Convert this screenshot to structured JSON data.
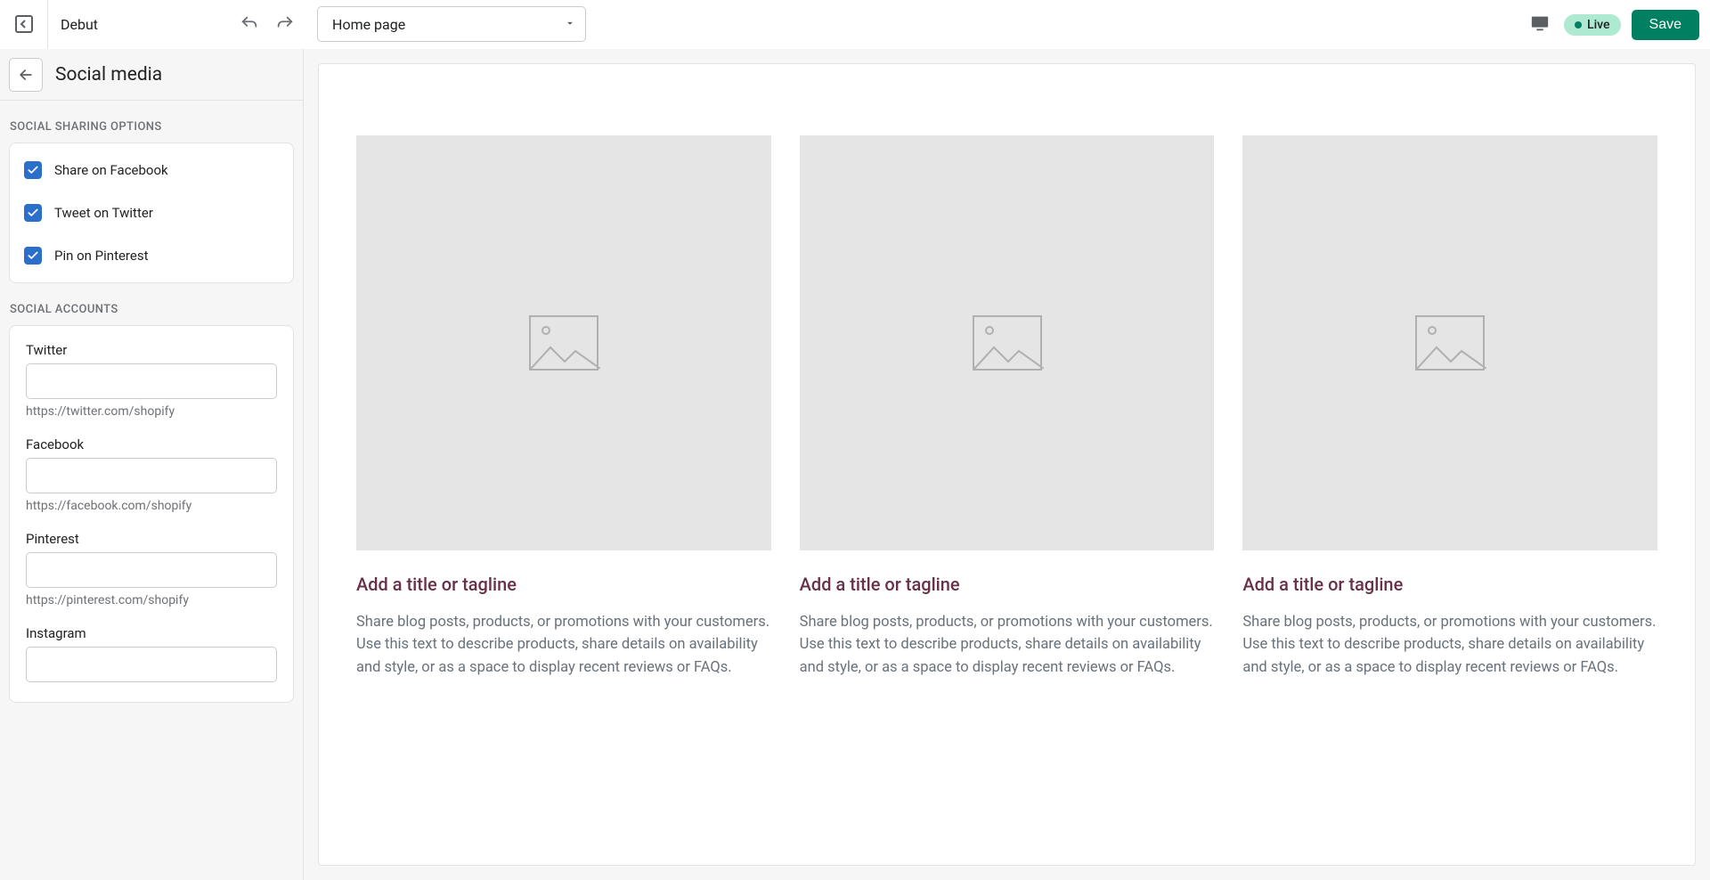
{
  "topbar": {
    "theme_name": "Debut",
    "page_select_value": "Home page",
    "live_label": "Live",
    "save_label": "Save"
  },
  "sidebar": {
    "title": "Social media",
    "section_sharing": "Social sharing options",
    "section_accounts": "Social accounts",
    "sharing_options": [
      {
        "label": "Share on Facebook",
        "checked": true
      },
      {
        "label": "Tweet on Twitter",
        "checked": true
      },
      {
        "label": "Pin on Pinterest",
        "checked": true
      }
    ],
    "accounts": [
      {
        "label": "Twitter",
        "value": "",
        "hint": "https://twitter.com/shopify"
      },
      {
        "label": "Facebook",
        "value": "",
        "hint": "https://facebook.com/shopify"
      },
      {
        "label": "Pinterest",
        "value": "",
        "hint": "https://pinterest.com/shopify"
      },
      {
        "label": "Instagram",
        "value": "",
        "hint": ""
      }
    ]
  },
  "preview": {
    "columns": [
      {
        "title": "Add a title or tagline",
        "body": "Share blog posts, products, or promotions with your customers. Use this text to describe products, share details on availability and style, or as a space to display recent reviews or FAQs."
      },
      {
        "title": "Add a title or tagline",
        "body": "Share blog posts, products, or promotions with your customers. Use this text to describe products, share details on availability and style, or as a space to display recent reviews or FAQs."
      },
      {
        "title": "Add a title or tagline",
        "body": "Share blog posts, products, or promotions with your customers. Use this text to describe products, share details on availability and style, or as a space to display recent reviews or FAQs."
      }
    ]
  }
}
